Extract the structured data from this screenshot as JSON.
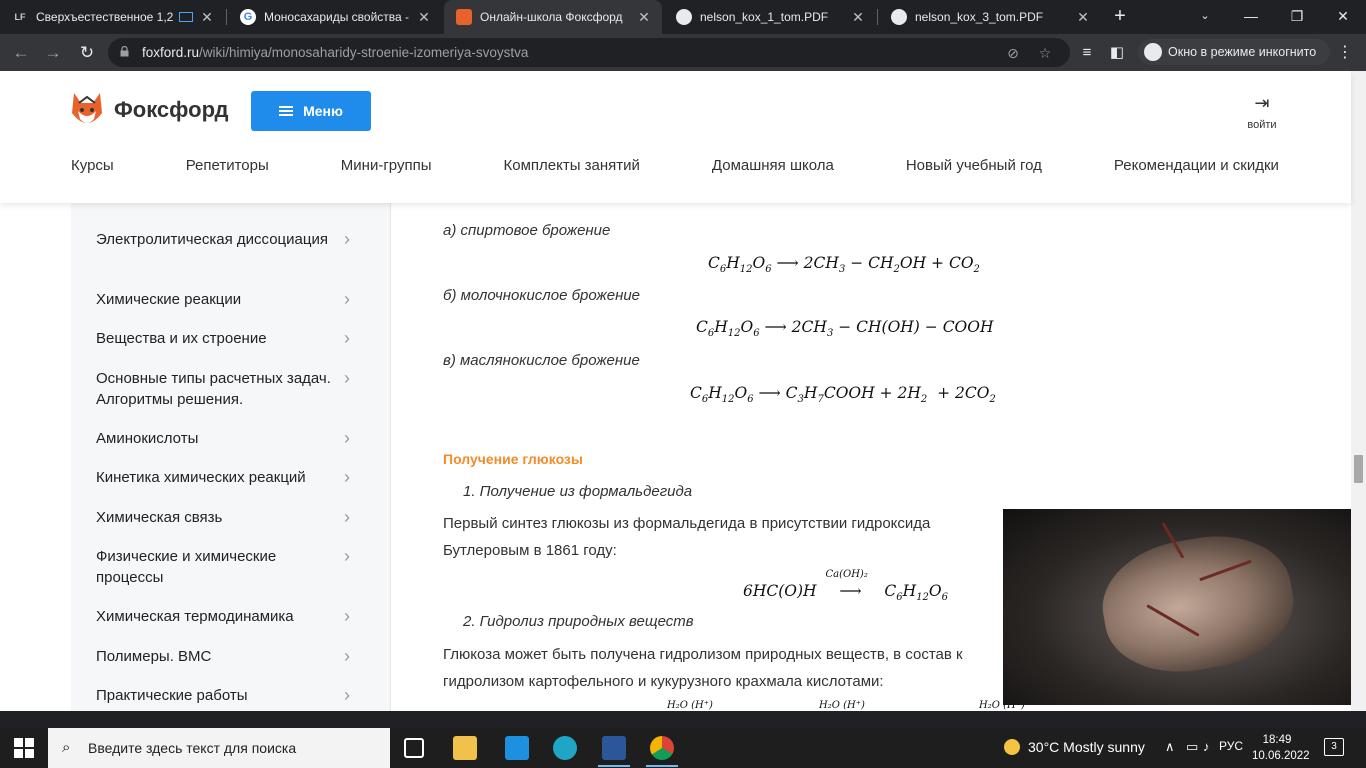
{
  "browser": {
    "tabs": [
      {
        "title": "Сверхъестественное 1,2",
        "favicon": "lf-logo-icon",
        "active": false
      },
      {
        "title": "Моносахариды свойства - Г",
        "favicon": "google-icon",
        "active": false
      },
      {
        "title": "Онлайн-школа Фоксфорд",
        "favicon": "foxford-icon",
        "active": true
      },
      {
        "title": "nelson_kox_1_tom.PDF",
        "favicon": "globe-icon",
        "active": false
      },
      {
        "title": "nelson_kox_3_tom.PDF",
        "favicon": "globe-icon",
        "active": false
      }
    ],
    "url_domain": "foxford.ru",
    "url_path": "/wiki/himiya/monosaharidy-stroenie-izomeriya-svoystva",
    "incognito_label": "Окно в режиме инкогнито"
  },
  "site": {
    "brand": "Фоксфорд",
    "menu_label": "Меню",
    "login_label": "войти",
    "nav": [
      "Курсы",
      "Репетиторы",
      "Мини-группы",
      "Комплекты занятий",
      "Домашняя школа",
      "Новый учебный год",
      "Рекомендации и скидки"
    ],
    "accent": "#1f8ceb",
    "section_color": "#f28c28"
  },
  "sidebar": {
    "items": [
      "Электролитическая диссоциация",
      "Химические реакции",
      "Вещества и их строение",
      "Основные типы расчетных задач. Алгоритмы решения.",
      "Аминокислоты",
      "Кинетика химических реакций",
      "Химическая связь",
      "Физические и химические процессы",
      "Химическая термодинамика",
      "Полимеры. ВМС",
      "Практические работы"
    ]
  },
  "content": {
    "a_label": "а) спиртовое брожение",
    "b_label": "б) молочнокислое брожение",
    "c_label": "в) маслянокислое брожение",
    "section_title": "Получение глюкозы",
    "sub1": "1. Получение из формальдегида",
    "p1_line1": "Первый синтез глюкозы из формальдегида в присутствии гидроксида",
    "p1_line2": "Бутлеровым в 1861 году:",
    "f4_catalyst": "Ca(OH)₂",
    "sub2": "2. Гидролиз природных веществ",
    "p2_line1": "Глюкоза может быть получена гидролизом природных веществ, в состав к",
    "p2_line2": "гидролизом картофельного и кукурузного крахмала кислотами:",
    "f5_labels": [
      "H₂O (H⁺)",
      "H₂O (H⁺)",
      "H₂O (H⁺)"
    ]
  },
  "taskbar": {
    "search_placeholder": "Введите здесь текст для поиска",
    "weather": "30°C  Mostly sunny",
    "lang": "РУС",
    "time": "18:49",
    "date": "10.06.2022",
    "notifications": "3"
  }
}
